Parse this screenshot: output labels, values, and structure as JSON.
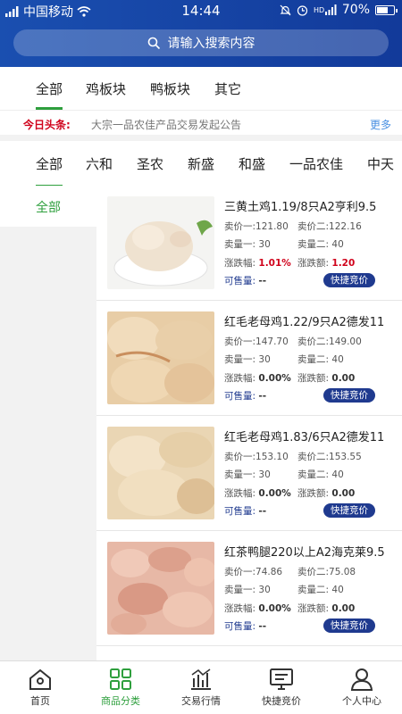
{
  "status_bar": {
    "carrier": "中国移动",
    "time": "14:44",
    "battery": "70%",
    "battery_level": 0.7
  },
  "search": {
    "placeholder": "请输入搜索内容"
  },
  "top_tabs": [
    "全部",
    "鸡板块",
    "鸭板块",
    "其它"
  ],
  "headline": {
    "label": "今日头条:",
    "text": "大宗一品农佳产品交易发起公告",
    "more": "更多"
  },
  "vendor_tabs": [
    "全部",
    "六和",
    "圣农",
    "新盛",
    "和盛",
    "一品农佳",
    "中天"
  ],
  "sidebar": {
    "item": "全部"
  },
  "products": [
    {
      "name": "三黄土鸡1.19/8只A2亨利9.5",
      "price1_label": "卖价一:",
      "price1": "121.80",
      "price2_label": "卖价二:",
      "price2": "122.16",
      "qty1_label": "卖量一:",
      "qty1": "30",
      "qty2_label": "卖量二:",
      "qty2": "40",
      "rate_label": "涨跌幅:",
      "rate": "1.01%",
      "amount_label": "涨跌额:",
      "amount": "1.20",
      "avail_label": "可售量:",
      "avail": "--",
      "bid": "快捷竞价"
    },
    {
      "name": "红毛老母鸡1.22/9只A2德发11",
      "price1_label": "卖价一:",
      "price1": "147.70",
      "price2_label": "卖价二:",
      "price2": "149.00",
      "qty1_label": "卖量一:",
      "qty1": "30",
      "qty2_label": "卖量二:",
      "qty2": "40",
      "rate_label": "涨跌幅:",
      "rate": "0.00%",
      "amount_label": "涨跌额:",
      "amount": "0.00",
      "avail_label": "可售量:",
      "avail": "--",
      "bid": "快捷竞价"
    },
    {
      "name": "红毛老母鸡1.83/6只A2德发11",
      "price1_label": "卖价一:",
      "price1": "153.10",
      "price2_label": "卖价二:",
      "price2": "153.55",
      "qty1_label": "卖量一:",
      "qty1": "30",
      "qty2_label": "卖量二:",
      "qty2": "40",
      "rate_label": "涨跌幅:",
      "rate": "0.00%",
      "amount_label": "涨跌额:",
      "amount": "0.00",
      "avail_label": "可售量:",
      "avail": "--",
      "bid": "快捷竞价"
    },
    {
      "name": "红茶鸭腿220以上A2海克莱9.5",
      "price1_label": "卖价一:",
      "price1": "74.86",
      "price2_label": "卖价二:",
      "price2": "75.08",
      "qty1_label": "卖量一:",
      "qty1": "30",
      "qty2_label": "卖量二:",
      "qty2": "40",
      "rate_label": "涨跌幅:",
      "rate": "0.00%",
      "amount_label": "涨跌额:",
      "amount": "0.00",
      "avail_label": "可售量:",
      "avail": "--",
      "bid": "快捷竞价"
    }
  ],
  "bottom_nav": [
    "首页",
    "商品分类",
    "交易行情",
    "快捷竞价",
    "个人中心"
  ],
  "colors": {
    "header": "#1a4fb0",
    "accent_green": "#2e9f3d",
    "bid_button": "#1f3a8f",
    "up_red": "#d0021b"
  }
}
